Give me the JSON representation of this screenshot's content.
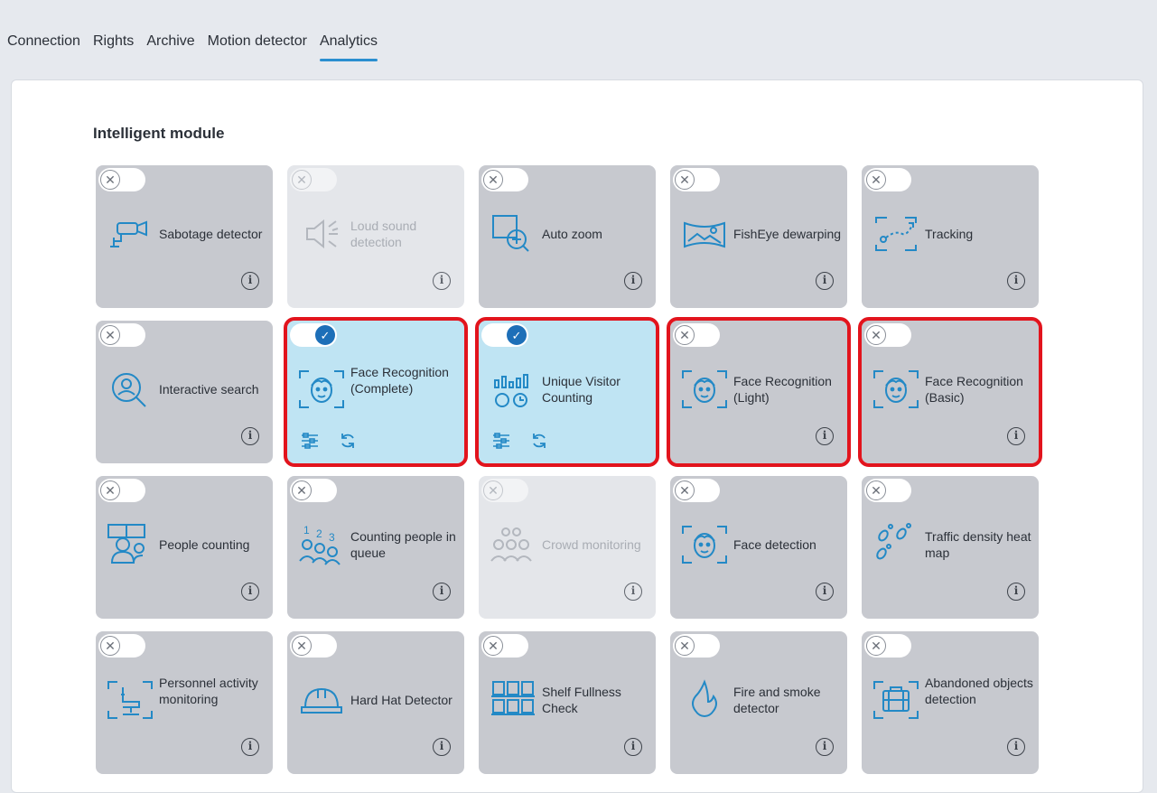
{
  "tabs": [
    {
      "label": "Connection"
    },
    {
      "label": "Rights"
    },
    {
      "label": "Archive"
    },
    {
      "label": "Motion detector"
    },
    {
      "label": "Analytics",
      "active": true
    }
  ],
  "section_title": "Intelligent module",
  "colors": {
    "accent": "#2389c6",
    "card_bg": "#c7c9cf",
    "card_active_bg": "#bfe4f3",
    "highlight": "#e2141d"
  },
  "modules": [
    {
      "label": "Sabotage detector",
      "icon": "camera-sabotage-icon",
      "state": "off"
    },
    {
      "label": "Loud sound detection",
      "icon": "speaker-icon",
      "state": "disabled"
    },
    {
      "label": "Auto zoom",
      "icon": "zoom-in-icon",
      "state": "off"
    },
    {
      "label": "FishEye dewarping",
      "icon": "panorama-icon",
      "state": "off"
    },
    {
      "label": "Tracking",
      "icon": "tracking-path-icon",
      "state": "off"
    },
    {
      "label": "Interactive search",
      "icon": "person-search-icon",
      "state": "off"
    },
    {
      "label": "Face Recognition (Complete)",
      "icon": "face-frame-icon",
      "state": "on",
      "highlight": true
    },
    {
      "label": "Unique Visitor Counting",
      "icon": "visitor-stats-icon",
      "state": "on",
      "highlight": true
    },
    {
      "label": "Face Recognition (Light)",
      "icon": "face-frame-icon",
      "state": "off",
      "highlight": true
    },
    {
      "label": "Face Recognition (Basic)",
      "icon": "face-frame-icon",
      "state": "off",
      "highlight": true
    },
    {
      "label": "People counting",
      "icon": "people-counting-icon",
      "state": "off"
    },
    {
      "label": "Counting people in queue",
      "icon": "queue-icon",
      "state": "off"
    },
    {
      "label": "Crowd monitoring",
      "icon": "crowd-icon",
      "state": "disabled"
    },
    {
      "label": "Face detection",
      "icon": "face-frame-icon",
      "state": "off"
    },
    {
      "label": "Traffic density heat map",
      "icon": "footprints-icon",
      "state": "off"
    },
    {
      "label": "Personnel activity monitoring",
      "icon": "office-chair-icon",
      "state": "off"
    },
    {
      "label": "Hard Hat Detector",
      "icon": "hard-hat-icon",
      "state": "off"
    },
    {
      "label": "Shelf Fullness Check",
      "icon": "shelf-icon",
      "state": "off"
    },
    {
      "label": "Fire and smoke detector",
      "icon": "fire-icon",
      "state": "off"
    },
    {
      "label": "Abandoned objects detection",
      "icon": "suitcase-icon",
      "state": "off"
    }
  ]
}
